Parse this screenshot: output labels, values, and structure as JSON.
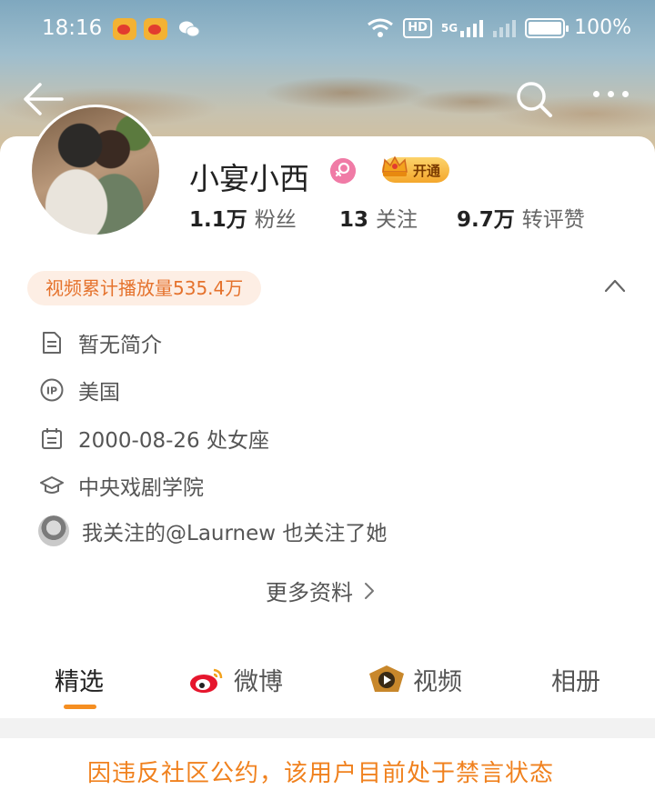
{
  "status_bar": {
    "time": "18:16",
    "network_label": "HD",
    "signal_label": "5G",
    "battery": "100%"
  },
  "profile": {
    "name": "小宴小西",
    "vip_label": "开通",
    "stats": [
      {
        "num": "1.1万",
        "label": "粉丝"
      },
      {
        "num": "13",
        "label": "关注"
      },
      {
        "num": "9.7万",
        "label": "转评赞"
      }
    ],
    "video_plays": "视频累计播放量535.4万",
    "info": {
      "bio": "暂无简介",
      "ip": "美国",
      "birthday": "2000-08-26 处女座",
      "school": "中央戏剧学院",
      "mutual": "我关注的@Laurnew 也关注了她"
    },
    "more_info": "更多资料"
  },
  "tabs": [
    {
      "label": "精选",
      "icon": "none"
    },
    {
      "label": "微博",
      "icon": "weibo-icon"
    },
    {
      "label": "视频",
      "icon": "video-icon"
    },
    {
      "label": "相册",
      "icon": "none"
    }
  ],
  "notice": "因违反社区公约，该用户目前处于禁言状态",
  "colors": {
    "accent": "#f58e21",
    "notice": "#f0811e",
    "video_badge_bg": "#fdeee4",
    "gender": "#f07ba6"
  }
}
